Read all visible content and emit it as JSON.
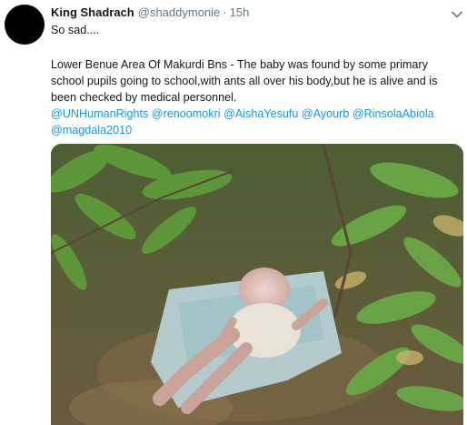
{
  "tweet": {
    "display_name": "King Shadrach",
    "handle": "@shaddymonie",
    "separator": "·",
    "timestamp": "15h",
    "line1": "So sad....",
    "body": "Lower Benue Area Of Makurdi Bns - The baby was found by some primary school pupils going to school,with ants all over his body,but he is alive and is been checked by medical personnel.",
    "mentions": [
      "@UNHumanRights",
      "@renoomokri",
      "@AishaYesufu",
      "@Ayourb",
      "@RinsolaAbiola",
      "@magdala2010"
    ]
  },
  "icons": {
    "caret": "chevron-down-icon"
  },
  "colors": {
    "text": "#14171a",
    "secondary": "#657786",
    "link": "#1b95e0",
    "background": "#ffffff"
  }
}
